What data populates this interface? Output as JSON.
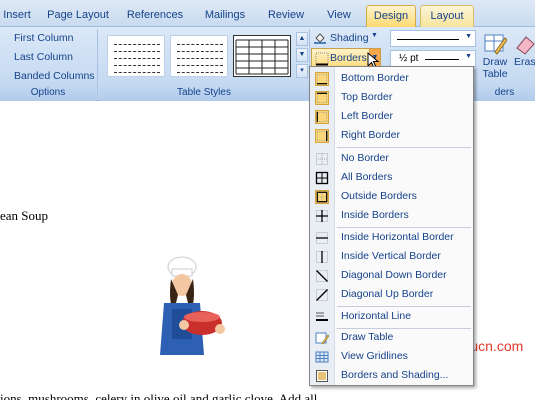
{
  "ribbon_tabs": [
    "Insert",
    "Page Layout",
    "References",
    "Mailings",
    "Review",
    "View",
    "Design",
    "Layout"
  ],
  "options_group": {
    "items": [
      "First Column",
      "Last Column",
      "Banded Columns"
    ],
    "caption": "Options"
  },
  "styles_group": {
    "caption": "Table Styles"
  },
  "shading_label": "Shading",
  "borders_label": "Borders",
  "pen_weight": "½ pt",
  "draw_table_label": [
    "Draw",
    "Table"
  ],
  "eraser_label": "Eras",
  "borders_group_caption_partial": "ders",
  "menu_items": [
    "Bottom Border",
    "Top Border",
    "Left Border",
    "Right Border",
    "No Border",
    "All Borders",
    "Outside Borders",
    "Inside Borders",
    "Inside Horizontal Border",
    "Inside Vertical Border",
    "Diagonal Down Border",
    "Diagonal Up Border",
    "Horizontal Line",
    "Draw Table",
    "View Gridlines",
    "Borders and Shading..."
  ],
  "document": {
    "line1": "ean Soup",
    "line2": "ions, mushrooms, celery in olive oil and garlic clove. Add all"
  },
  "watermark": "Yuucn.com",
  "colors": {
    "ribbon_text": "#15428b",
    "highlight": "#fbd77a",
    "watermark": "#e0382c"
  }
}
